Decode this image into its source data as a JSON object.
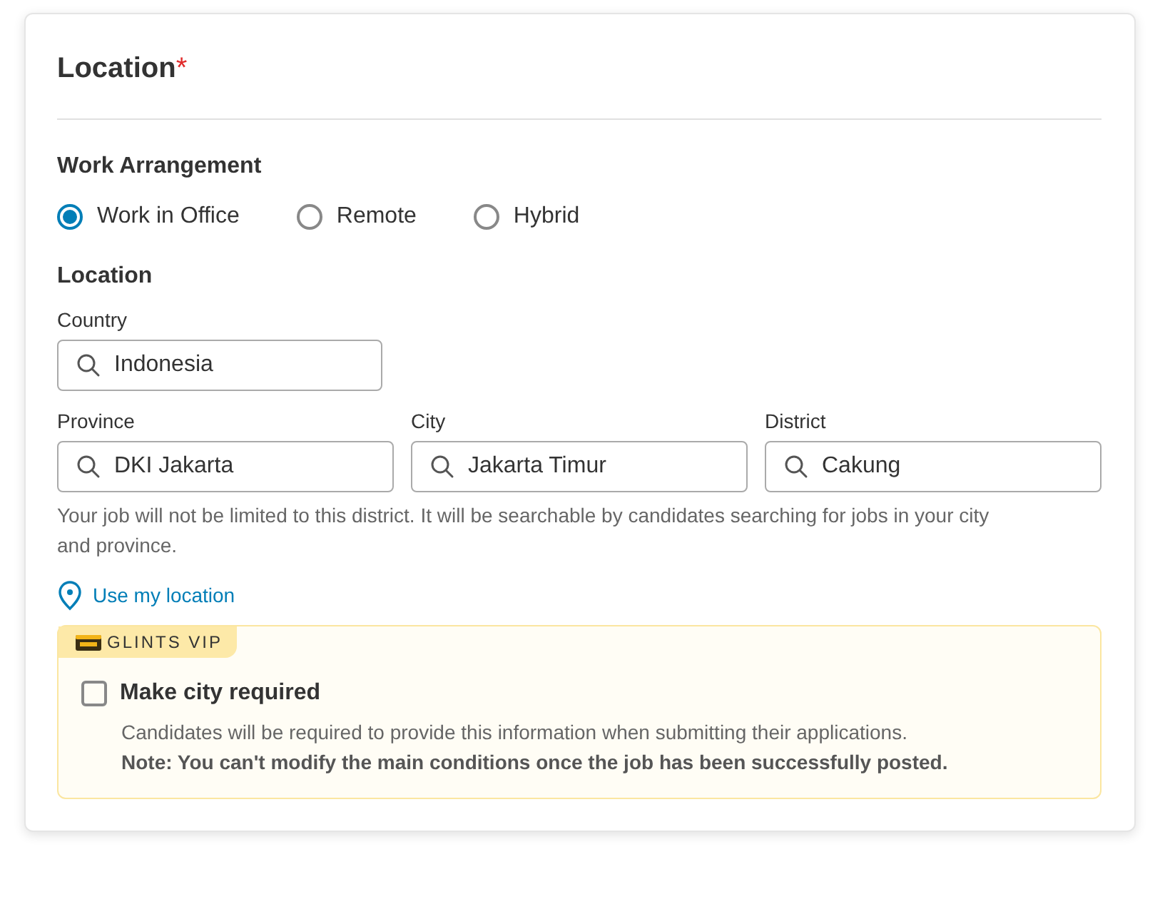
{
  "card": {
    "title": "Location",
    "required_mark": "*"
  },
  "work_arrangement": {
    "label": "Work Arrangement",
    "options": [
      {
        "label": "Work in Office",
        "selected": true
      },
      {
        "label": "Remote",
        "selected": false
      },
      {
        "label": "Hybrid",
        "selected": false
      }
    ]
  },
  "location": {
    "label": "Location",
    "country": {
      "label": "Country",
      "value": "Indonesia"
    },
    "fields": [
      {
        "label": "Province",
        "value": "DKI Jakarta"
      },
      {
        "label": "City",
        "value": "Jakarta Timur"
      },
      {
        "label": "District",
        "value": "Cakung"
      }
    ],
    "hint": "Your job will not be limited to this district. It will be searchable by candidates searching for jobs in your city and province.",
    "use_location": "Use my location"
  },
  "vip": {
    "badge": "GLINTS VIP",
    "checkbox": {
      "label": "Make city required",
      "checked": false
    },
    "description": "Candidates will be required to provide this information when submitting their applications.",
    "note": "Note: You can't modify the main conditions once the job has been successfully posted."
  }
}
